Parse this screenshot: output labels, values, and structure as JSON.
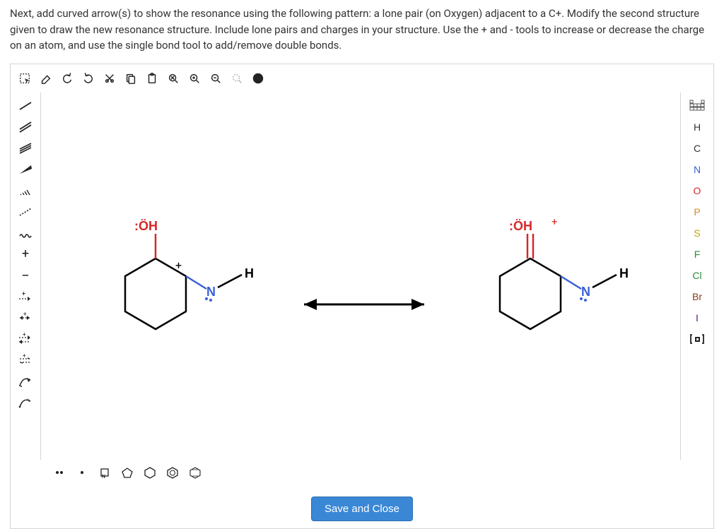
{
  "instructions": "Next, add curved arrow(s) to show the resonance using the following pattern: a lone pair (on Oxygen) adjacent to a C+. Modify the second structure given to draw the new resonance structure. Include lone pairs and charges in your structure. Use the + and - tools to increase or decrease the charge on an atom, and use the single bond tool to add/remove double bonds.",
  "save_label": "Save and Close",
  "top_tools": [
    {
      "name": "selection-tool",
      "title": "Selection"
    },
    {
      "name": "eraser-icon",
      "title": "Eraser"
    },
    {
      "name": "undo-icon",
      "title": "Undo"
    },
    {
      "name": "redo-icon",
      "title": "Redo"
    },
    {
      "name": "cut-icon",
      "title": "Cut"
    },
    {
      "name": "copy-icon",
      "title": "Copy"
    },
    {
      "name": "paste-icon",
      "title": "Paste"
    },
    {
      "name": "zoom-fit-icon",
      "title": "Zoom to Fit"
    },
    {
      "name": "zoom-in-icon",
      "title": "Zoom In"
    },
    {
      "name": "zoom-out-icon",
      "title": "Zoom Out"
    },
    {
      "name": "zoom-selection-icon",
      "title": "Zoom Selection"
    },
    {
      "name": "help-icon",
      "title": "Help"
    }
  ],
  "left_tools": [
    {
      "name": "single-bond",
      "title": "Single Bond"
    },
    {
      "name": "double-bond",
      "title": "Double Bond"
    },
    {
      "name": "triple-bond",
      "title": "Triple Bond"
    },
    {
      "name": "wedge-bond",
      "title": "Wedge Bond"
    },
    {
      "name": "hash-bond",
      "title": "Hash Bond"
    },
    {
      "name": "dashed-bond",
      "title": "Dashed Bond"
    },
    {
      "name": "wavy-bond",
      "title": "Wavy Bond"
    },
    {
      "name": "charge-plus",
      "title": "Increase Charge",
      "label": "+"
    },
    {
      "name": "charge-minus",
      "title": "Decrease Charge",
      "label": "−"
    },
    {
      "name": "mapping-plus",
      "title": "Mapping +"
    },
    {
      "name": "mapping-swap",
      "title": "Mapping swap"
    },
    {
      "name": "mapping-plus2",
      "title": "Mapping +"
    },
    {
      "name": "mapping-equil",
      "title": "Equilibrium"
    },
    {
      "name": "curved-arrow-full",
      "title": "Curved Arrow (pair)"
    },
    {
      "name": "curved-arrow-half",
      "title": "Curved Arrow (single)"
    }
  ],
  "right_tools": [
    {
      "name": "periodic-table-icon",
      "label": "",
      "special": "table"
    },
    {
      "name": "element-H",
      "label": "H",
      "cls": "c-H"
    },
    {
      "name": "element-C",
      "label": "C",
      "cls": "c-C"
    },
    {
      "name": "element-N",
      "label": "N",
      "cls": "c-N"
    },
    {
      "name": "element-O",
      "label": "O",
      "cls": "c-O"
    },
    {
      "name": "element-P",
      "label": "P",
      "cls": "c-P"
    },
    {
      "name": "element-S",
      "label": "S",
      "cls": "c-S"
    },
    {
      "name": "element-F",
      "label": "F",
      "cls": "c-F"
    },
    {
      "name": "element-Cl",
      "label": "Cl",
      "cls": "c-Cl"
    },
    {
      "name": "element-Br",
      "label": "Br",
      "cls": "c-Br"
    },
    {
      "name": "element-I",
      "label": "I",
      "cls": "c-I"
    },
    {
      "name": "custom-label-icon",
      "label": "",
      "special": "bracket"
    }
  ],
  "bottom_tools": [
    {
      "name": "lone-pair-icon",
      "title": "Lone pair"
    },
    {
      "name": "radical-icon",
      "title": "Radical"
    },
    {
      "name": "n-square-icon",
      "title": "N-square"
    },
    {
      "name": "pentagon-icon",
      "title": "Cyclopentane"
    },
    {
      "name": "hexagon-icon",
      "title": "Cyclohexane"
    },
    {
      "name": "benzene-icon",
      "title": "Benzene"
    },
    {
      "name": "cube-icon",
      "title": "3D ring"
    }
  ],
  "molecules": {
    "left": {
      "OH_label": ":ÖH",
      "H_label": "H",
      "N_label": "N",
      "plus": "+"
    },
    "right": {
      "OH_label": ":ÖH",
      "charge": "+",
      "H_label": "H",
      "N_label": "N"
    }
  }
}
